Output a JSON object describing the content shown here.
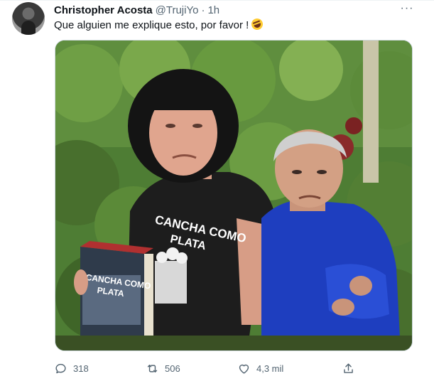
{
  "tweet": {
    "author_name": "Christopher Acosta",
    "author_handle": "@TrujiYo",
    "separator": "·",
    "time": "1h",
    "more_label": "···",
    "text": "Que alguien me explique esto, por favor !",
    "emoji": "rolling-on-the-floor-laughing-emoji",
    "photo": {
      "shirt_text": [
        "CANCHA COMO",
        "PLATA"
      ],
      "book_text": [
        "CANCHA COMO",
        "PLATA"
      ]
    }
  },
  "actions": {
    "reply_count": "318",
    "retweet_count": "506",
    "like_count": "4,3 mil",
    "share_icon": "share-icon"
  },
  "colors": {
    "text_primary": "#0f1419",
    "text_secondary": "#536471",
    "border": "#cfd9de"
  }
}
